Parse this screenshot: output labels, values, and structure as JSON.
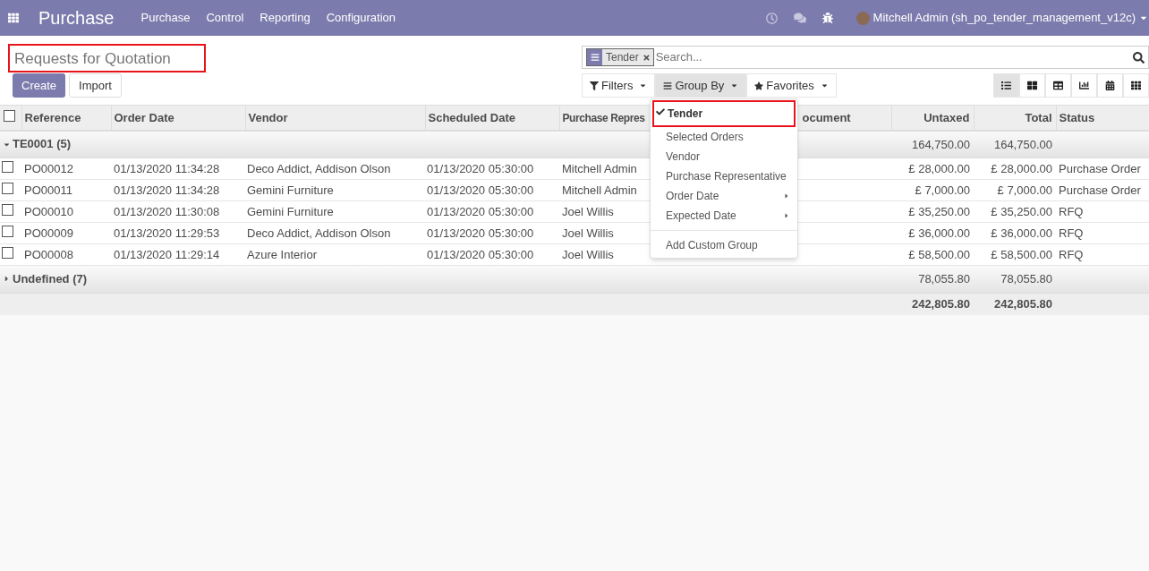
{
  "navbar": {
    "app_title": "Purchase",
    "menus": [
      "Purchase",
      "Control",
      "Reporting",
      "Configuration"
    ],
    "user": "Mitchell Admin (sh_po_tender_management_v12c)"
  },
  "breadcrumb": "Requests for Quotation",
  "buttons": [
    {
      "label": "Create",
      "kind": "primary"
    },
    {
      "label": "Import",
      "kind": "secondary"
    }
  ],
  "search": {
    "facet": "Tender",
    "placeholder": "Search..."
  },
  "search_buttons": [
    {
      "label": "Filters",
      "selected": false
    },
    {
      "label": "Group By",
      "selected": true
    },
    {
      "label": "Favorites",
      "selected": false
    }
  ],
  "views": [
    {
      "selected": true
    },
    {
      "selected": false
    },
    {
      "selected": false
    },
    {
      "selected": false
    },
    {
      "selected": false
    },
    {
      "selected": false
    }
  ],
  "groupby_menu": {
    "items": [
      {
        "label": "Tender",
        "checked": true,
        "submenu": false
      },
      {
        "label": "Selected Orders",
        "checked": false,
        "submenu": false
      },
      {
        "label": "Vendor",
        "checked": false,
        "submenu": false
      },
      {
        "label": "Purchase Representative",
        "checked": false,
        "submenu": false
      },
      {
        "label": "Order Date",
        "checked": false,
        "submenu": true
      },
      {
        "label": "Expected Date",
        "checked": false,
        "submenu": true
      }
    ],
    "custom": "Add Custom Group"
  },
  "table": {
    "all_checked": false,
    "columns": [
      "Reference",
      "Order Date",
      "Vendor",
      "Scheduled Date",
      "Purchase Repres",
      "ocument",
      "Untaxed",
      "Total",
      "Status"
    ],
    "groups": [
      {
        "label": "TE0001 (5)",
        "expanded": true,
        "untaxed": "164,750.00",
        "total": "164,750.00",
        "rows": [
          {
            "checked": false,
            "reference": "PO00012",
            "order_date": "01/13/2020 11:34:28",
            "vendor": "Deco Addict, Addison Olson",
            "scheduled_date": "01/13/2020 05:30:00",
            "representative": "Mitchell Admin",
            "untaxed": "£ 28,000.00",
            "total": "£ 28,000.00",
            "status": "Purchase Order"
          },
          {
            "checked": false,
            "reference": "PO00011",
            "order_date": "01/13/2020 11:34:28",
            "vendor": "Gemini Furniture",
            "scheduled_date": "01/13/2020 05:30:00",
            "representative": "Mitchell Admin",
            "untaxed": "£ 7,000.00",
            "total": "£ 7,000.00",
            "status": "Purchase Order"
          },
          {
            "checked": false,
            "reference": "PO00010",
            "order_date": "01/13/2020 11:30:08",
            "vendor": "Gemini Furniture",
            "scheduled_date": "01/13/2020 05:30:00",
            "representative": "Joel Willis",
            "untaxed": "£ 35,250.00",
            "total": "£ 35,250.00",
            "status": "RFQ"
          },
          {
            "checked": false,
            "reference": "PO00009",
            "order_date": "01/13/2020 11:29:53",
            "vendor": "Deco Addict, Addison Olson",
            "scheduled_date": "01/13/2020 05:30:00",
            "representative": "Joel Willis",
            "untaxed": "£ 36,000.00",
            "total": "£ 36,000.00",
            "status": "RFQ"
          },
          {
            "checked": false,
            "reference": "PO00008",
            "order_date": "01/13/2020 11:29:14",
            "vendor": "Azure Interior",
            "scheduled_date": "01/13/2020 05:30:00",
            "representative": "Joel Willis",
            "untaxed": "£ 58,500.00",
            "total": "£ 58,500.00",
            "status": "RFQ"
          }
        ]
      },
      {
        "label": "Undefined (7)",
        "expanded": false,
        "untaxed": "78,055.80",
        "total": "78,055.80"
      }
    ],
    "footer": {
      "untaxed": "242,805.80",
      "total": "242,805.80"
    }
  }
}
